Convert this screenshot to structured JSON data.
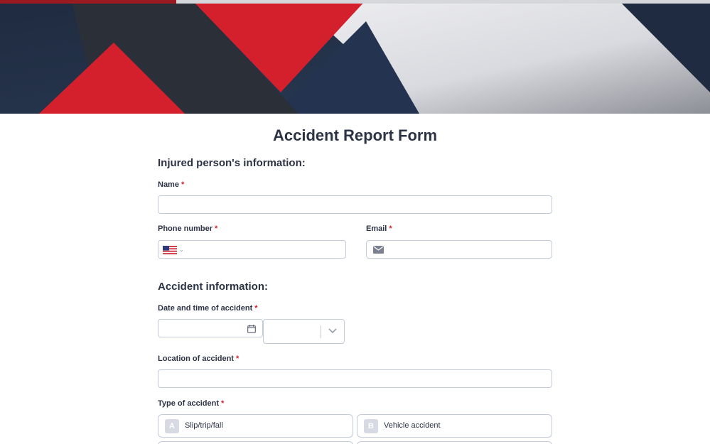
{
  "form": {
    "title": "Accident Report Form",
    "section_injured": "Injured person's information:",
    "section_accident": "Accident information:"
  },
  "fields": {
    "name": {
      "label": "Name",
      "required_mark": "*",
      "value": ""
    },
    "phone": {
      "label": "Phone number",
      "required_mark": "*",
      "value": "",
      "country_flag_icon": "us-flag-icon"
    },
    "email": {
      "label": "Email",
      "required_mark": "*",
      "value": "",
      "icon": "envelope-icon"
    },
    "date_time": {
      "label": "Date and time of accident",
      "required_mark": "*",
      "date_value": "",
      "time_value": ""
    },
    "location": {
      "label": "Location of accident",
      "required_mark": "*",
      "value": ""
    },
    "type": {
      "label": "Type of accident",
      "required_mark": "*",
      "options": [
        {
          "key": "A",
          "text": "Slip/trip/fall"
        },
        {
          "key": "B",
          "text": "Vehicle accident"
        }
      ]
    }
  },
  "colors": {
    "required": "#d4202c",
    "banner_red": "#d4202c",
    "banner_navy": "#24324a",
    "banner_dark": "#2b2f38",
    "text": "#2c3345"
  }
}
